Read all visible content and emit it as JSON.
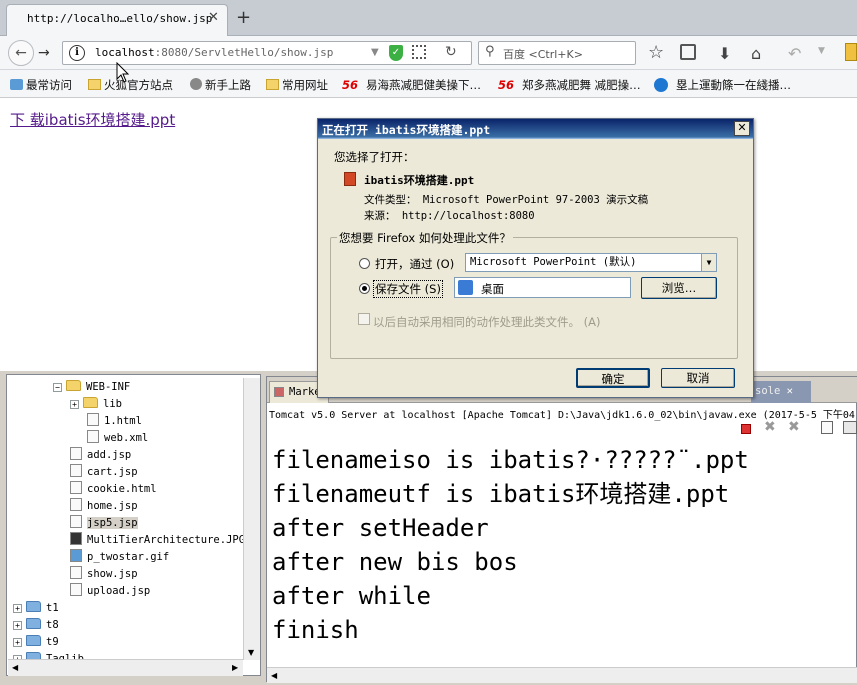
{
  "browser": {
    "tab_title": "http://localho…ello/show.jsp",
    "tab_close": "✕",
    "new_tab": "+",
    "url_host": "localhost",
    "url_rest": ":8080/ServletHello/show.jsp",
    "search_placeholder": "百度 <Ctrl+K>",
    "bookmarks": [
      "最常访问",
      "火狐官方站点",
      "新手上路",
      "常用网址",
      "易海燕减肥健美操下…",
      "郑多燕减肥舞 减肥操…",
      "塁上運動篨一在綫播…"
    ],
    "bookmark_badge": "56"
  },
  "page": {
    "download_link": "下 载ibatis环境搭建.ppt"
  },
  "dialog": {
    "title": "正在打开 ibatis环境搭建.ppt",
    "close": "✕",
    "intro": "您选择了打开：",
    "filename": "ibatis环境搭建.ppt",
    "file_type": "文件类型： Microsoft PowerPoint 97-2003 演示文稿",
    "source": "来源： http://localhost:8080",
    "question": "您想要 Firefox 如何处理此文件？",
    "open_with_label": "打开，通过 (O)",
    "open_with_app": "Microsoft PowerPoint (默认)",
    "save_file_label": "保存文件 (S)",
    "save_location": "桌面",
    "browse": "浏览…",
    "auto_checkbox": "以后自动采用相同的动作处理此类文件。 (A)",
    "ok": "确定",
    "cancel": "取消",
    "selected_option": "save"
  },
  "project_tree": [
    {
      "label": "WEB-INF",
      "kind": "folder",
      "expander": "−"
    },
    {
      "label": "lib",
      "kind": "folder",
      "expander": "+"
    },
    {
      "label": "1.html",
      "kind": "file"
    },
    {
      "label": "web.xml",
      "kind": "file"
    },
    {
      "label": "add.jsp",
      "kind": "file"
    },
    {
      "label": "cart.jsp",
      "kind": "file"
    },
    {
      "label": "cookie.html",
      "kind": "file"
    },
    {
      "label": "home.jsp",
      "kind": "file"
    },
    {
      "label": "jsp5.jsp",
      "kind": "file",
      "selected": true
    },
    {
      "label": "MultiTierArchitecture.JPG",
      "kind": "file"
    },
    {
      "label": "p_twostar.gif",
      "kind": "file"
    },
    {
      "label": "show.jsp",
      "kind": "file"
    },
    {
      "label": "upload.jsp",
      "kind": "file"
    },
    {
      "label": "t1",
      "kind": "project",
      "expander": "+"
    },
    {
      "label": "t8",
      "kind": "project",
      "expander": "+"
    },
    {
      "label": "t9",
      "kind": "project",
      "expander": "+"
    },
    {
      "label": "Taglib",
      "kind": "project",
      "expander": "+"
    }
  ],
  "console": {
    "tab_markers": "Marke",
    "tab_console": "sole",
    "tab_close": "✕",
    "status": "Tomcat v5.0 Server at localhost [Apache Tomcat] D:\\Java\\jdk1.6.0_02\\bin\\javaw.exe (2017-5-5 下午04",
    "lines": [
      "filenameiso is ibatis?·?????¨.ppt",
      "filenameutf is ibatis环境搭建.ppt",
      "after setHeader",
      "after new bis bos",
      "after while",
      "finish"
    ]
  }
}
